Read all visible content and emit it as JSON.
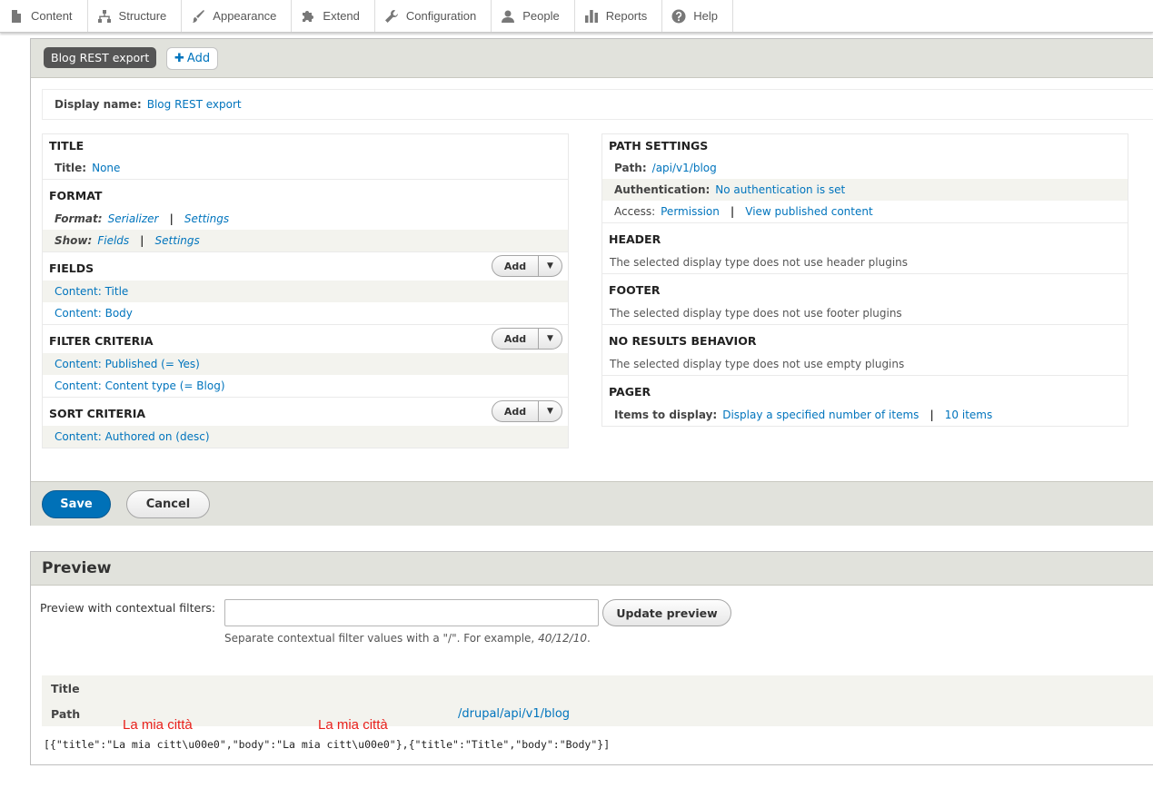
{
  "toolbar": {
    "items": [
      {
        "label": "Content",
        "icon": "file-icon"
      },
      {
        "label": "Structure",
        "icon": "sitemap-icon"
      },
      {
        "label": "Appearance",
        "icon": "paintbrush-icon"
      },
      {
        "label": "Extend",
        "icon": "puzzle-icon"
      },
      {
        "label": "Configuration",
        "icon": "wrench-icon"
      },
      {
        "label": "People",
        "icon": "person-icon"
      },
      {
        "label": "Reports",
        "icon": "bar-chart-icon"
      },
      {
        "label": "Help",
        "icon": "help-icon"
      }
    ]
  },
  "tabs": {
    "active": "Blog REST export",
    "add_label": "Add"
  },
  "display_name": {
    "label": "Display name:",
    "value": "Blog REST export"
  },
  "left": {
    "title": {
      "heading": "TITLE",
      "label": "Title:",
      "value": "None"
    },
    "format": {
      "heading": "FORMAT",
      "format_label": "Format:",
      "format_value": "Serializer",
      "format_settings": "Settings",
      "show_label": "Show:",
      "show_value": "Fields",
      "show_settings": "Settings"
    },
    "fields": {
      "heading": "FIELDS",
      "add": "Add",
      "items": [
        "Content: Title",
        "Content: Body"
      ]
    },
    "filter": {
      "heading": "FILTER CRITERIA",
      "add": "Add",
      "items": [
        "Content: Published (= Yes)",
        "Content: Content type (= Blog)"
      ]
    },
    "sort": {
      "heading": "SORT CRITERIA",
      "add": "Add",
      "items": [
        "Content: Authored on (desc)"
      ]
    }
  },
  "right": {
    "path_settings": {
      "heading": "PATH SETTINGS",
      "path_label": "Path:",
      "path_value": "/api/v1/blog",
      "auth_label": "Authentication:",
      "auth_value": "No authentication is set",
      "access_label": "Access:",
      "access_value": "Permission",
      "access_detail": "View published content"
    },
    "header": {
      "heading": "HEADER",
      "text": "The selected display type does not use header plugins"
    },
    "footer": {
      "heading": "FOOTER",
      "text": "The selected display type does not use footer plugins"
    },
    "no_results": {
      "heading": "NO RESULTS BEHAVIOR",
      "text": "The selected display type does not use empty plugins"
    },
    "pager": {
      "heading": "PAGER",
      "label": "Items to display:",
      "value": "Display a specified number of items",
      "count": "10 items"
    }
  },
  "actions": {
    "save": "Save",
    "cancel": "Cancel"
  },
  "preview": {
    "heading": "Preview",
    "filter_label": "Preview with contextual filters:",
    "input_value": "",
    "update_button": "Update preview",
    "help_text": "Separate contextual filter values with a \"/\". For example, ",
    "help_example": "40/12/10",
    "help_end": ".",
    "table": {
      "title_label": "Title",
      "path_label": "Path",
      "path_value": "/drupal/api/v1/blog"
    },
    "annotations": [
      "La mia città",
      "La mia città"
    ],
    "json_output": "[{\"title\":\"La mia citt\\u00e0\",\"body\":\"La mia citt\\u00e0\"},{\"title\":\"Title\",\"body\":\"Body\"}]"
  }
}
